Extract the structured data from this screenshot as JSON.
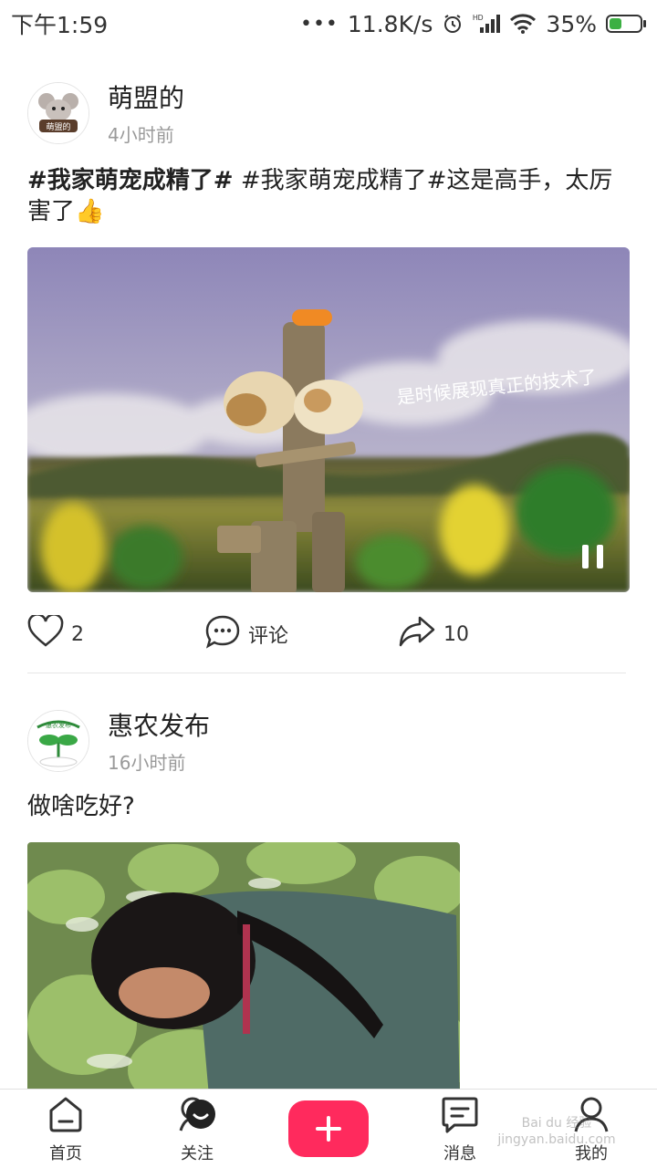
{
  "status_bar": {
    "time": "下午1:59",
    "network_speed": "11.8K/s",
    "signal_label": "HD",
    "battery": "35%",
    "battery_level": 0.35
  },
  "posts": [
    {
      "author": "萌盟的",
      "avatar_text": "萌盟的",
      "time": "4小时前",
      "tag": "#我家萌宠成精了#",
      "text": " #我家萌宠成精了#这是高手，太厉害了👍",
      "video_caption": "是时候展现真正的技术了",
      "like_count": "2",
      "comment_label": "评论",
      "share_count": "10"
    },
    {
      "author": "惠农发布",
      "avatar_text": "惠农发布",
      "time": "16小时前",
      "text": "做啥吃好?"
    }
  ],
  "tabbar": {
    "items": [
      {
        "label": "首页"
      },
      {
        "label": "关注"
      },
      {
        "label": ""
      },
      {
        "label": "消息"
      },
      {
        "label": "我的"
      }
    ]
  },
  "watermark": "Bai du 经验 jingyan.baidu.com",
  "colors": {
    "accent": "#ff2a5d",
    "battery_fill": "#3cb043"
  }
}
